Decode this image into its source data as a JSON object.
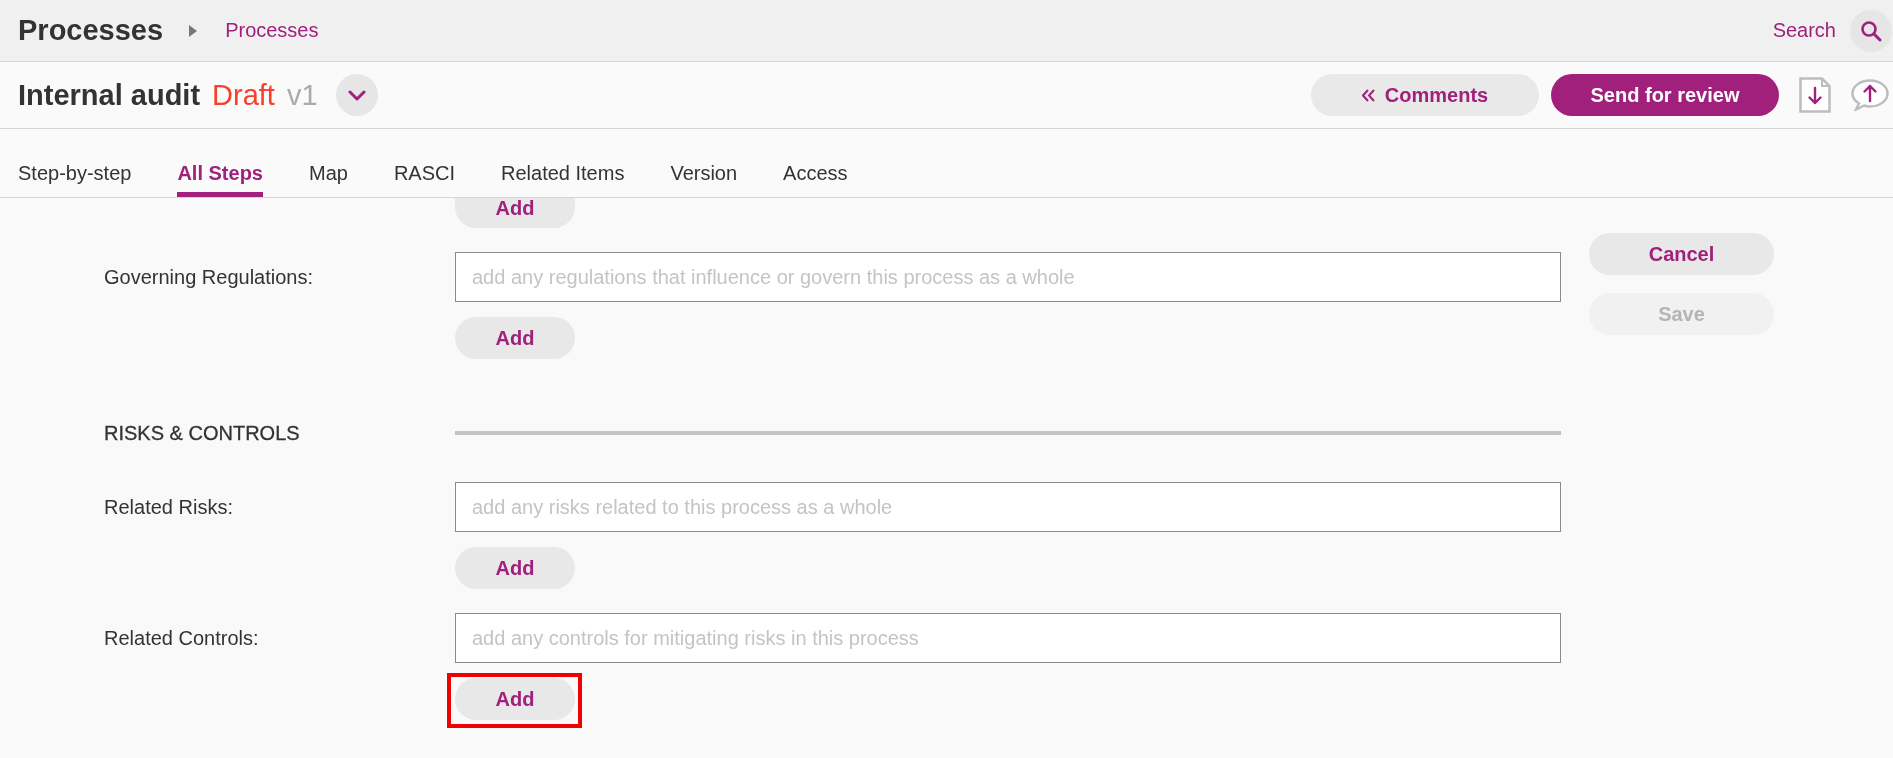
{
  "header": {
    "title": "Processes",
    "breadcrumb": "Processes",
    "search": "Search"
  },
  "document": {
    "title": "Internal audit",
    "status": "Draft",
    "version": "v1"
  },
  "actions": [
    {
      "kind": "secondary",
      "label": "Comments"
    },
    {
      "kind": "primary",
      "label": "Send for review"
    }
  ],
  "tabs": [
    {
      "label": "Step-by-step",
      "selected": false
    },
    {
      "label": "All Steps",
      "selected": true
    },
    {
      "label": "Map",
      "selected": false
    },
    {
      "label": "RASCI",
      "selected": false
    },
    {
      "label": "Related Items",
      "selected": false
    },
    {
      "label": "Version",
      "selected": false
    },
    {
      "label": "Access",
      "selected": false
    }
  ],
  "form": {
    "rows": [
      {
        "kind": "button",
        "button": "Add",
        "highlighted": false
      },
      {
        "kind": "field",
        "label": "Governing Regulations:",
        "placeholder": "add any regulations that influence or govern this process as a whole",
        "button": "Add",
        "highlighted": false
      },
      {
        "kind": "section",
        "title": "RISKS & CONTROLS"
      },
      {
        "kind": "field",
        "label": "Related Risks:",
        "placeholder": "add any risks related to this process as a whole",
        "button": "Add",
        "highlighted": false
      },
      {
        "kind": "field",
        "label": "Related Controls:",
        "placeholder": "add any controls for mitigating risks in this process",
        "button": "Add",
        "highlighted": true
      }
    ]
  },
  "side_buttons": [
    {
      "label": "Cancel",
      "disabled": false
    },
    {
      "label": "Save",
      "disabled": true
    }
  ]
}
